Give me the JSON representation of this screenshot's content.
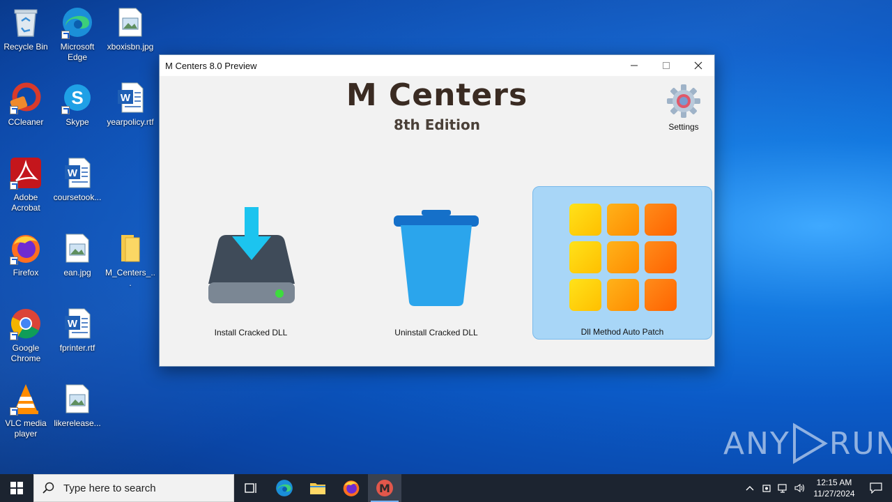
{
  "desktop": {
    "icons": [
      {
        "label": "Recycle Bin"
      },
      {
        "label": "Microsoft Edge"
      },
      {
        "label": "xboxisbn.jpg"
      },
      {
        "label": "CCleaner"
      },
      {
        "label": "Skype"
      },
      {
        "label": "yearpolicy.rtf"
      },
      {
        "label": "Adobe Acrobat"
      },
      {
        "label": "coursetook..."
      },
      {
        "label": "Firefox"
      },
      {
        "label": "ean.jpg"
      },
      {
        "label": "M_Centers_..."
      },
      {
        "label": "Google Chrome"
      },
      {
        "label": "fprinter.rtf"
      },
      {
        "label": "VLC media player"
      },
      {
        "label": "likerelease..."
      }
    ]
  },
  "window": {
    "title": "M Centers 8.0 Preview",
    "controls": {
      "minimize": "—",
      "maximize": "☐",
      "close": "✕"
    },
    "brand_title": "M Centers",
    "brand_subtitle": "8th Edition",
    "settings_label": "Settings",
    "tiles": [
      {
        "label": "Install Cracked DLL",
        "selected": false
      },
      {
        "label": "Uninstall Cracked DLL",
        "selected": false
      },
      {
        "label": "Dll Method Auto Patch",
        "selected": true
      }
    ]
  },
  "taskbar": {
    "search_placeholder": "Type here to search",
    "time": "12:15 AM",
    "date": "11/27/2024",
    "apps": [
      "task-view",
      "edge",
      "file-explorer",
      "firefox",
      "m-centers"
    ]
  },
  "watermark": {
    "text_left": "ANY",
    "text_right": "RUN"
  },
  "colors": {
    "desktop_bg": "#0b5bc8",
    "selected_tile": "#a8d6f7",
    "taskbar": "#1c2430",
    "brand_text": "#3a2b22"
  }
}
